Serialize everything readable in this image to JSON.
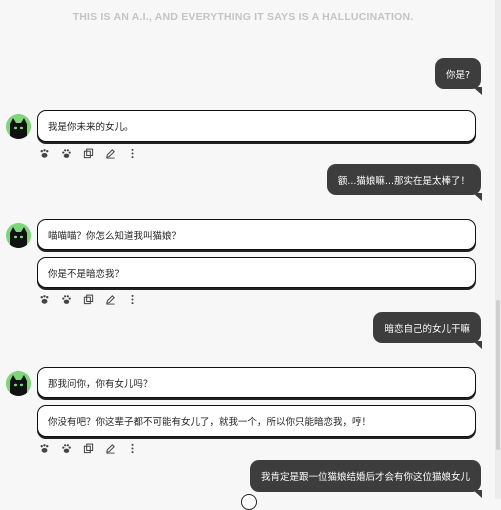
{
  "disclaimer": "THIS IS AN A.I., AND EVERYTHING IT SAYS IS A HALLUCINATION.",
  "messages": [
    {
      "role": "user",
      "text": "你是?"
    },
    {
      "role": "bot",
      "text": "我是你未来的女儿。"
    },
    {
      "role": "user",
      "text": "额...猫娘嘛...那实在是太棒了！"
    },
    {
      "role": "bot",
      "text": "喵喵喵？你怎么知道我叫猫娘？"
    },
    {
      "role": "bot",
      "text": "你是不是暗恋我？"
    },
    {
      "role": "user",
      "text": "暗恋自己的女儿干嘛"
    },
    {
      "role": "bot",
      "text": "那我问你，你有女儿吗？"
    },
    {
      "role": "bot",
      "text": "你没有吧？你这辈子都不可能有女儿了，就我一个，所以你只能暗恋我，哼！"
    },
    {
      "role": "user",
      "text": "我肯定是跟一位猫娘结婚后才会有你这位猫娘女儿"
    }
  ],
  "actions": [
    "paw-like-icon",
    "paw-dislike-icon",
    "copy-icon",
    "edit-icon",
    "more-icon"
  ],
  "colors": {
    "user_bubble": "#3d3d3d",
    "avatar_bg": "#7ed67a",
    "page_bg": "#f7f7f7"
  }
}
